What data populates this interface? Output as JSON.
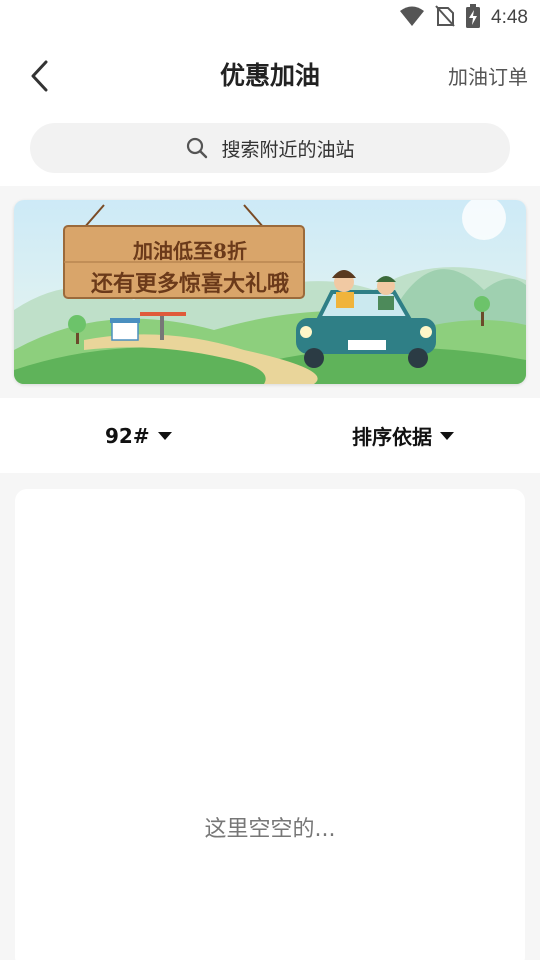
{
  "status_bar": {
    "time": "4:48",
    "icons": [
      "wifi-icon",
      "no-sim-icon",
      "battery-charging-icon"
    ]
  },
  "header": {
    "title": "优惠加油",
    "back_icon": "chevron-left-icon",
    "orders_link": "加油订单"
  },
  "search": {
    "icon": "search-icon",
    "placeholder": "搜索附近的油站"
  },
  "banner": {
    "line1": "加油低至8折",
    "line2": "还有更多惊喜大礼哦"
  },
  "filters": {
    "fuel": {
      "label": "92#",
      "icon": "caret-down-icon"
    },
    "sort": {
      "label": "排序依据",
      "icon": "caret-down-icon"
    }
  },
  "list": {
    "empty_text": "这里空空的..."
  }
}
